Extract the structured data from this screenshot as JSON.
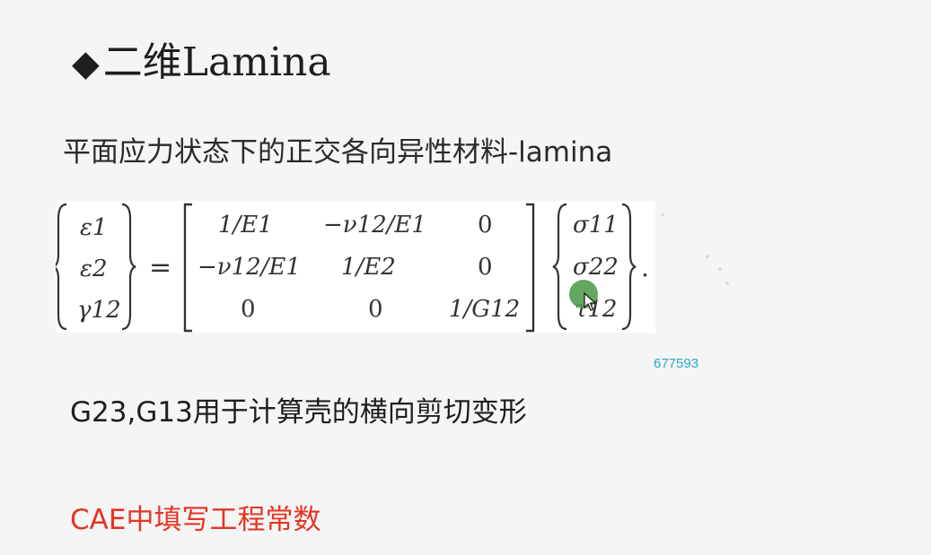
{
  "slide": {
    "bullet": "◆",
    "title": "二维Lamina",
    "subtitle": "平面应力状态下的正交各向异性材料-lamina",
    "note": "G23,G13用于计算壳的横向剪切变形",
    "cae_line": "CAE中填写工程常数",
    "watermark": "677593"
  },
  "equation": {
    "lhs": [
      "ε1",
      "ε2",
      "γ12"
    ],
    "matrix": [
      [
        "1/E1",
        "−ν12/E1",
        "0"
      ],
      [
        "−ν12/E1",
        "1/E2",
        "0"
      ],
      [
        "0",
        "0",
        "1/G12"
      ]
    ],
    "rhs": [
      "σ11",
      "σ22",
      "τ12"
    ],
    "equals": "=",
    "end": "."
  },
  "colors": {
    "background": "#f5f5f5",
    "note_red": "#e53424",
    "watermark": "#2aa7c9",
    "cursor": "#4e9b4a"
  },
  "icons": {
    "bullet": "diamond-bullet-icon",
    "cursor": "mouse-cursor-icon"
  }
}
